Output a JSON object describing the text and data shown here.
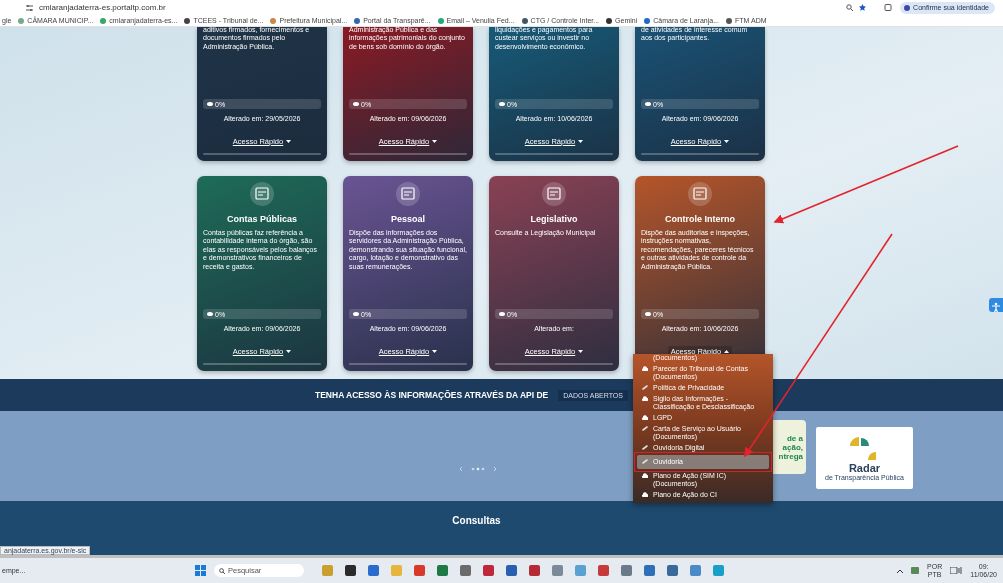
{
  "browser": {
    "url": "cmlaranjadaterra-es.portaltp.com.br",
    "identity_button": "Confirme sua identidade"
  },
  "bookmarks": [
    {
      "label": "gle"
    },
    {
      "label": "CÂMARA MUNICIP..."
    },
    {
      "label": "cmlaranjadaterra-es..."
    },
    {
      "label": "TCEES - Tribunal de..."
    },
    {
      "label": "Prefeitura Municipal..."
    },
    {
      "label": "Portal da Transparê..."
    },
    {
      "label": "Email – Venulia Fed..."
    },
    {
      "label": "CTG / Controle Inter..."
    },
    {
      "label": "Gemini"
    },
    {
      "label": "Câmara de Laranja..."
    },
    {
      "label": "FTM ADM"
    }
  ],
  "top_cards": [
    {
      "description": "aditivos firmados, fornecimentos e documentos firmados pelo Administração Pública.",
      "views": "0%",
      "updated": "Alterado em: 29/05/2026",
      "link": "Acesso Rápido",
      "color": "#1f3448"
    },
    {
      "description": "Administração Pública e das informações patrimoniais do conjunto de bens sob domínio do órgão.",
      "views": "0%",
      "updated": "Alterado em: 09/06/2026",
      "link": "Acesso Rápido",
      "color": "#8a1a24"
    },
    {
      "description": "liquidações e pagamentos para custear serviços ou investir no desenvolvimento econômico.",
      "views": "0%",
      "updated": "Alterado em: 10/06/2026",
      "link": "Acesso Rápido",
      "color": "#175a78"
    },
    {
      "description": "de atividades de interesse comum aos dos participantes.",
      "views": "0%",
      "updated": "Alterado em: 09/06/2026",
      "link": "Acesso Rápido",
      "color": "#1a5275"
    }
  ],
  "cards": [
    {
      "title": "Contas Públicas",
      "description": "Contas públicas faz referência a contabilidade interna do órgão, são elas as responsáveis pelos balanços e demonstrativos financeiros de receita e gastos.",
      "views": "0%",
      "updated": "Alterado em: 09/06/2026",
      "link": "Acesso Rápido",
      "color": "#1e6b58",
      "expanded": false
    },
    {
      "title": "Pessoal",
      "description": "Dispõe das informações dos servidores da Administração Pública, demonstrando sua situação funcional, cargo, lotação e demonstrativo das suas remunerações.",
      "views": "0%",
      "updated": "Alterado em: 09/06/2026",
      "link": "Acesso Rápido",
      "color": "#6a5494",
      "expanded": false
    },
    {
      "title": "Legislativo",
      "description": "Consulte a Legislação Municipal",
      "views": "0%",
      "updated": "Alterado em:",
      "link": "Acesso Rápido",
      "color": "#8a4154",
      "expanded": false
    },
    {
      "title": "Controle Interno",
      "description": "Dispõe das auditorias e inspeções, instruções normativas, recomendações, pareceres técnicos e outras atividades de controle da Administração Pública.",
      "views": "0%",
      "updated": "Alterado em: 10/06/2026",
      "link": "Acesso Rápido",
      "color": "#b5552a",
      "expanded": true
    }
  ],
  "menu": {
    "items": [
      {
        "label": "(Documentos)",
        "kind": "none",
        "selected": false
      },
      {
        "label": "Parecer do Tribunal de Contas (Documentos)",
        "kind": "cloud",
        "selected": false
      },
      {
        "label": "Política de Privacidade",
        "kind": "link",
        "selected": false
      },
      {
        "label": "Sigilo das Informações - Classificação e Desclassificação",
        "kind": "cloud",
        "selected": false
      },
      {
        "label": "LGPD",
        "kind": "cloud",
        "selected": false
      },
      {
        "label": "Carta de Serviço ao Usuário (Documentos)",
        "kind": "link",
        "selected": false
      },
      {
        "label": "Ouvidoria Digital",
        "kind": "link",
        "selected": false
      },
      {
        "label": "Ouvidoria",
        "kind": "link",
        "selected": true
      },
      {
        "label": "Plano de Ação (SIM IC) (Documentos)",
        "kind": "cloud",
        "selected": false
      },
      {
        "label": "Plano de Ação do CI",
        "kind": "cloud",
        "selected": false
      }
    ]
  },
  "api_banner": {
    "text": "TENHA ACESSO ÀS INFORMAÇÕES ATRAVÉS DA API DE",
    "button": "DADOS ABERTOS"
  },
  "carousel": {
    "banner_lines": [
      "de a",
      "ação,",
      "ntrega"
    ],
    "radar": {
      "title": "Radar",
      "subtitle": "de Transparência Pública"
    }
  },
  "section_title": "Consultas",
  "status_url": "anjadaterra.es.gov.br/e-sic",
  "taskbar": {
    "widget": "empe...",
    "search": "Pesquisar",
    "language": [
      "POR",
      "PTB"
    ],
    "time": "09:",
    "date": "11/06/20"
  }
}
